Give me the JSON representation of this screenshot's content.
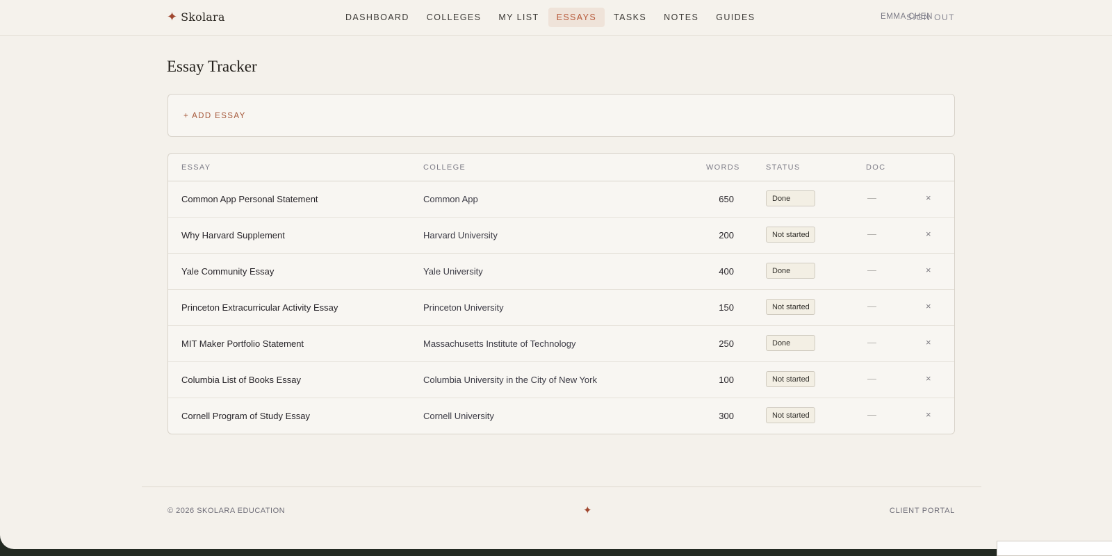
{
  "brand": {
    "name": "Skolara",
    "icon": "sparkle-icon",
    "accent": "#a0472f"
  },
  "nav": {
    "items": [
      {
        "label": "DASHBOARD"
      },
      {
        "label": "COLLEGES"
      },
      {
        "label": "MY LIST"
      },
      {
        "label": "ESSAYS",
        "active": true
      },
      {
        "label": "TASKS"
      },
      {
        "label": "NOTES"
      },
      {
        "label": "GUIDES"
      }
    ]
  },
  "user": {
    "name": "EMMA CHEN",
    "sign_out": "SIGN OUT"
  },
  "page": {
    "title": "Essay Tracker",
    "add_label": "+ ADD ESSAY"
  },
  "table": {
    "headers": {
      "essay": "ESSAY",
      "college": "COLLEGE",
      "words": "WORDS",
      "status": "STATUS",
      "doc": "DOC"
    },
    "rows": [
      {
        "essay": "Common App Personal Statement",
        "college": "Common App",
        "words": "650",
        "status": "Done",
        "doc": "—"
      },
      {
        "essay": "Why Harvard Supplement",
        "college": "Harvard University",
        "words": "200",
        "status": "Not started",
        "doc": "—"
      },
      {
        "essay": "Yale Community Essay",
        "college": "Yale University",
        "words": "400",
        "status": "Done",
        "doc": "—"
      },
      {
        "essay": "Princeton Extracurricular Activity Essay",
        "college": "Princeton University",
        "words": "150",
        "status": "Not started",
        "doc": "—"
      },
      {
        "essay": "MIT Maker Portfolio Statement",
        "college": "Massachusetts Institute of Technology",
        "words": "250",
        "status": "Done",
        "doc": "—"
      },
      {
        "essay": "Columbia List of Books Essay",
        "college": "Columbia University in the City of New York",
        "words": "100",
        "status": "Not started",
        "doc": "—"
      },
      {
        "essay": "Cornell Program of Study Essay",
        "college": "Cornell University",
        "words": "300",
        "status": "Not started",
        "doc": "—"
      }
    ],
    "remove_glyph": "×"
  },
  "footer": {
    "copyright": "© 2026 SKOLARA EDUCATION",
    "portal": "CLIENT PORTAL",
    "icon": "sparkle-icon"
  }
}
